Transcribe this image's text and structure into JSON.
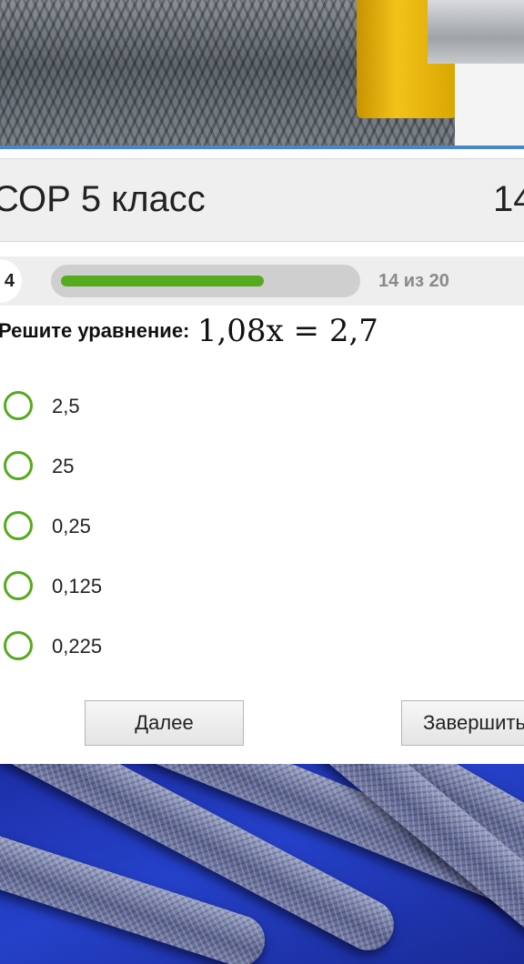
{
  "header": {
    "title": "СОР 5 класс",
    "counter": "14"
  },
  "progress": {
    "badge_number": "4",
    "status": "14 из 20",
    "fraction": 0.7,
    "bar_color": "#55aa1e"
  },
  "question": {
    "label": "Решите уравнение:",
    "equation": "1,08x = 2,7"
  },
  "options": [
    "2,5",
    "25",
    "0,25",
    "0,125",
    "0,225"
  ],
  "buttons": {
    "next_label": "Далее",
    "finish_label": "Завершить"
  },
  "colors": {
    "accent_green": "#55aa1e",
    "banner_line_blue": "#4a86c8"
  }
}
